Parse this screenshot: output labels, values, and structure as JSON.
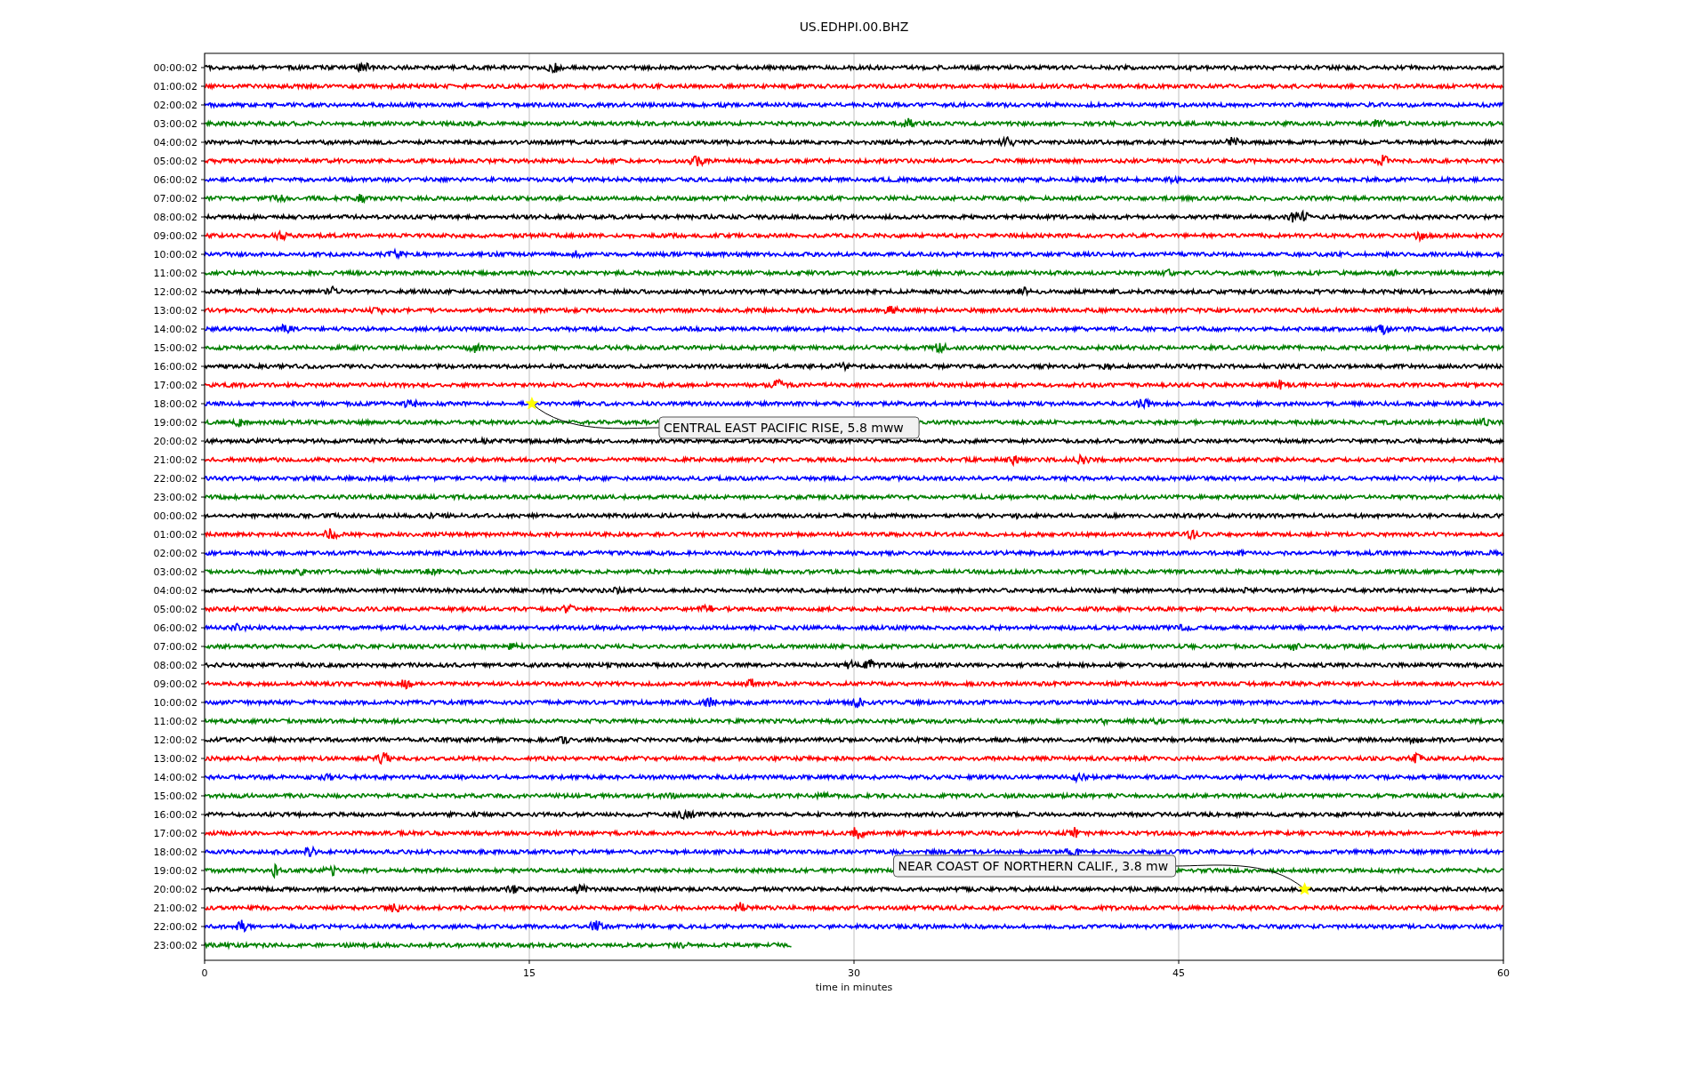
{
  "chart": {
    "title": "US.EDHPI.00.BHZ",
    "xlabel": "time in minutes",
    "xticks": [
      "0",
      "15",
      "30",
      "45",
      "60"
    ],
    "rows": [
      {
        "label": "00:00:02",
        "color": "#000000",
        "level": 1
      },
      {
        "label": "01:00:02",
        "color": "#ff0000",
        "level": 1
      },
      {
        "label": "02:00:02",
        "color": "#0000ff",
        "level": 1
      },
      {
        "label": "03:00:02",
        "color": "#008000",
        "level": 1
      },
      {
        "label": "04:00:02",
        "color": "#000000",
        "level": 1
      },
      {
        "label": "05:00:02",
        "color": "#ff0000",
        "level": 1
      },
      {
        "label": "06:00:02",
        "color": "#0000ff",
        "level": 1
      },
      {
        "label": "07:00:02",
        "color": "#008000",
        "level": 1
      },
      {
        "label": "08:00:02",
        "color": "#000000",
        "level": 1
      },
      {
        "label": "09:00:02",
        "color": "#ff0000",
        "level": 1
      },
      {
        "label": "10:00:02",
        "color": "#0000ff",
        "level": 1
      },
      {
        "label": "11:00:02",
        "color": "#008000",
        "level": 1
      },
      {
        "label": "12:00:02",
        "color": "#000000",
        "level": 1
      },
      {
        "label": "13:00:02",
        "color": "#ff0000",
        "level": 1
      },
      {
        "label": "14:00:02",
        "color": "#0000ff",
        "level": 1
      },
      {
        "label": "15:00:02",
        "color": "#008000",
        "level": 1
      },
      {
        "label": "16:00:02",
        "color": "#000000",
        "level": 1
      },
      {
        "label": "17:00:02",
        "color": "#ff0000",
        "level": 1
      },
      {
        "label": "18:00:02",
        "color": "#0000ff",
        "level": 1,
        "event": {
          "label": "CENTRAL EAST PACIFIC RISE, 5.8 mww"
        }
      },
      {
        "label": "19:00:02",
        "color": "#008000",
        "level": 1
      },
      {
        "label": "20:00:02",
        "color": "#000000",
        "level": 1
      },
      {
        "label": "21:00:02",
        "color": "#ff0000",
        "level": 1
      },
      {
        "label": "22:00:02",
        "color": "#0000ff",
        "level": 1
      },
      {
        "label": "23:00:02",
        "color": "#008000",
        "level": 1
      },
      {
        "label": "00:00:02",
        "color": "#000000",
        "level": 1
      },
      {
        "label": "01:00:02",
        "color": "#ff0000",
        "level": 1
      },
      {
        "label": "02:00:02",
        "color": "#0000ff",
        "level": 1
      },
      {
        "label": "03:00:02",
        "color": "#008000",
        "level": 1
      },
      {
        "label": "04:00:02",
        "color": "#000000",
        "level": 1
      },
      {
        "label": "05:00:02",
        "color": "#ff0000",
        "level": 1
      },
      {
        "label": "06:00:02",
        "color": "#0000ff",
        "level": 1
      },
      {
        "label": "07:00:02",
        "color": "#008000",
        "level": 1
      },
      {
        "label": "08:00:02",
        "color": "#000000",
        "level": 1
      },
      {
        "label": "09:00:02",
        "color": "#ff0000",
        "level": 1
      },
      {
        "label": "10:00:02",
        "color": "#0000ff",
        "level": 1
      },
      {
        "label": "11:00:02",
        "color": "#008000",
        "level": 1
      },
      {
        "label": "12:00:02",
        "color": "#000000",
        "level": 1
      },
      {
        "label": "13:00:02",
        "color": "#ff0000",
        "level": 1
      },
      {
        "label": "14:00:02",
        "color": "#0000ff",
        "level": 1
      },
      {
        "label": "15:00:02",
        "color": "#008000",
        "level": 1
      },
      {
        "label": "16:00:02",
        "color": "#000000",
        "level": 1
      },
      {
        "label": "17:00:02",
        "color": "#ff0000",
        "level": 1
      },
      {
        "label": "18:00:02",
        "color": "#0000ff",
        "level": 1
      },
      {
        "label": "19:00:02",
        "color": "#008000",
        "level": 1
      },
      {
        "label": "20:00:02",
        "color": "#000000",
        "level": 1,
        "event": {
          "label": "NEAR COAST OF NORTHERN CALIF., 3.8 mw"
        }
      },
      {
        "label": "21:00:02",
        "color": "#ff0000",
        "level": 1
      },
      {
        "label": "22:00:02",
        "color": "#0000ff",
        "level": 1
      },
      {
        "label": "23:00:02",
        "color": "#008000",
        "level": 0.452
      }
    ]
  }
}
